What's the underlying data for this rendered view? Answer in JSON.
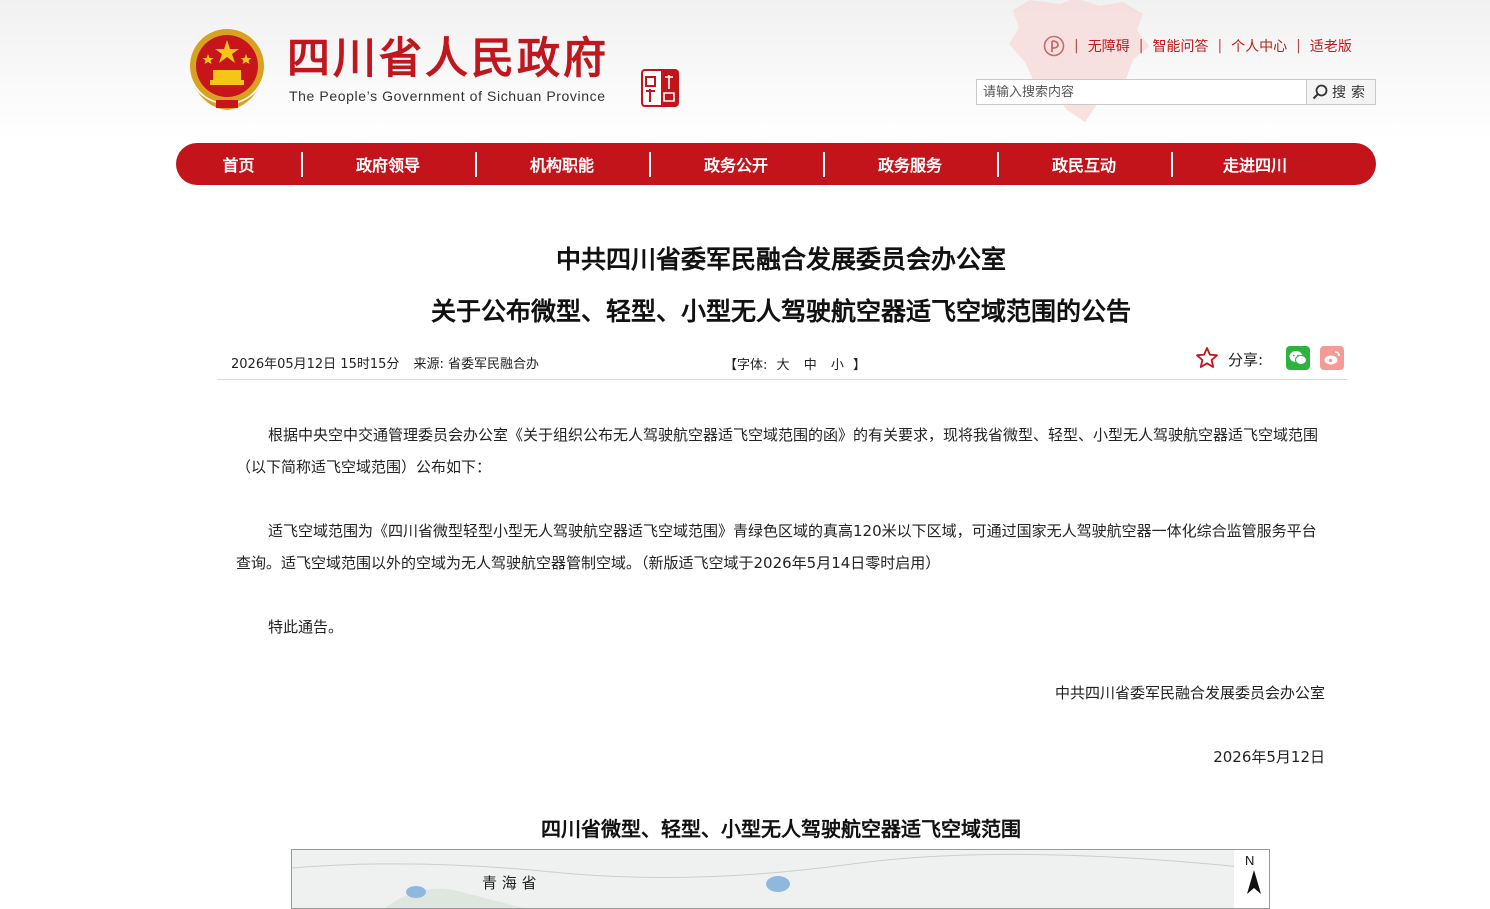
{
  "header": {
    "title": "四川省人民政府",
    "subtitle": "The People’s Government of Sichuan Province",
    "top_links": [
      "无障碍",
      "智能问答",
      "个人中心",
      "适老版"
    ],
    "search_placeholder": "请输入搜索内容",
    "search_button": "搜索",
    "seal_text": "中國四川"
  },
  "nav": {
    "items": [
      "首页",
      "政府领导",
      "机构职能",
      "政务公开",
      "政务服务",
      "政民互动",
      "走进四川"
    ]
  },
  "article": {
    "title_line1": "中共四川省委军民融合发展委员会办公室",
    "title_line2": "关于公布微型、轻型、小型无人驾驶航空器适飞空域范围的公告",
    "meta_time": "2026年05月12日 15时15分",
    "meta_source": "来源: 省委军民融合办",
    "font_label_open": "【字体:",
    "font_sizes": [
      "大",
      "中",
      "小"
    ],
    "font_label_close": "】",
    "share_label": "分享:",
    "paragraphs": [
      "根据中央空中交通管理委员会办公室《关于组织公布无人驾驶航空器适飞空域范围的函》的有关要求，现将我省微型、轻型、小型无人驾驶航空器适飞空域范围（以下简称适飞空域范围）公布如下：",
      "适飞空域范围为《四川省微型轻型小型无人驾驶航空器适飞空域范围》青绿色区域的真高120米以下区域，可通过国家无人驾驶航空器一体化综合监管服务平台查询。适飞空域范围以外的空域为无人驾驶航空器管制空域。（新版适飞空域于2026年5月14日零时启用）",
      "特此通告。"
    ],
    "signature": "中共四川省委军民融合发展委员会办公室",
    "date": "2026年5月12日",
    "map_title": "四川省微型、轻型、小型无人驾驶航空器适飞空域范围",
    "map_labels": {
      "north": "N",
      "qinghai": "青 海 省"
    }
  },
  "colors": {
    "brand_red": "#c3141b",
    "wechat_green": "#2eb43e",
    "weibo_pink": "#f39b94"
  }
}
